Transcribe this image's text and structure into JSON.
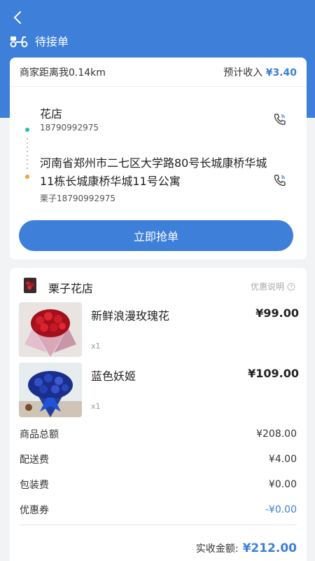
{
  "header": {
    "status_label": "待接单"
  },
  "order": {
    "distance_text": "商家距离我0.14km",
    "est_income_label": "预计收入",
    "est_income_value": "¥3.40",
    "pickup": {
      "name": "花店",
      "phone": "18790992975"
    },
    "dropoff": {
      "address": "河南省郑州市二七区大学路80号长城康桥华城11栋长城康桥华城11号公寓",
      "contact": "栗子18790992975"
    },
    "grab_label": "立即抢单"
  },
  "store": {
    "name": "栗子花店",
    "promo_label": "优惠说明"
  },
  "items": [
    {
      "name": "新鲜浪漫玫瑰花",
      "price": "¥99.00",
      "qty": "x1"
    },
    {
      "name": "蓝色妖姬",
      "price": "¥109.00",
      "qty": "x1"
    }
  ],
  "summary": {
    "goods_total_label": "商品总额",
    "goods_total_value": "¥208.00",
    "delivery_label": "配送费",
    "delivery_value": "¥4.00",
    "packing_label": "包装费",
    "packing_value": "¥0.00",
    "coupon_label": "优惠券",
    "coupon_value": "-¥0.00",
    "actual_label": "实收金额:",
    "actual_value": "¥212.00"
  },
  "colors": {
    "accent": "#3d7fd9",
    "pickup_dot": "#24c1a8",
    "dropoff_dot": "#f2a23a"
  }
}
